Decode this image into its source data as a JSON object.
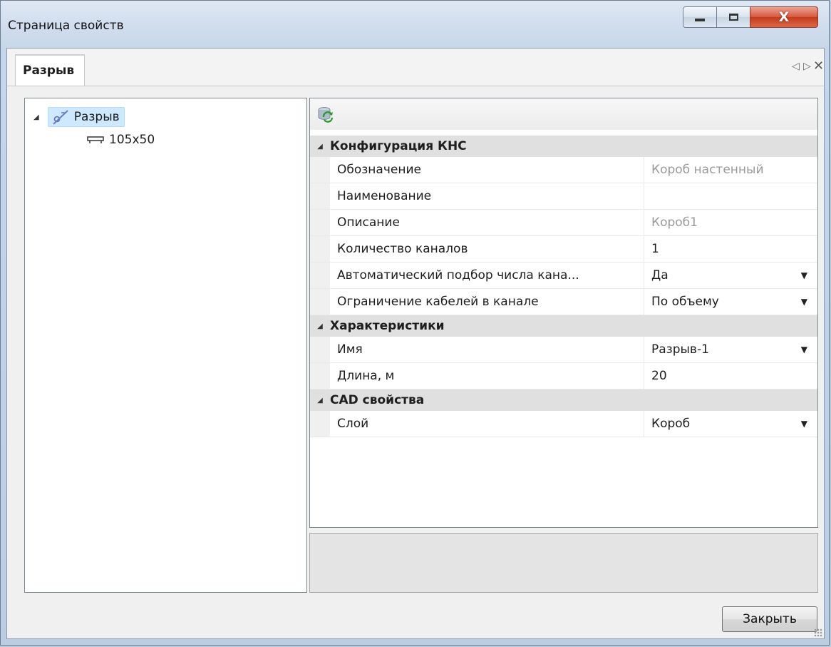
{
  "window": {
    "title": "Страница свойств",
    "close_glyph": "X"
  },
  "tab": {
    "label": "Разрыв",
    "prev_glyph": "◁",
    "next_glyph": "▷",
    "close_glyph": "✕"
  },
  "tree": {
    "root": {
      "label": "Разрыв",
      "icon": "break-line-icon",
      "selected": true,
      "expanded": true
    },
    "child": {
      "label": "105x50",
      "icon": "cable-tray-icon"
    }
  },
  "toolbar": {
    "refresh_icon": "refresh-db-icon"
  },
  "categories": [
    {
      "label": "Конфигурация КНС",
      "rows": [
        {
          "name": "Обозначение",
          "value": "Короб настенный",
          "readonly": true,
          "dropdown": false
        },
        {
          "name": "Наименование",
          "value": "",
          "readonly": false,
          "dropdown": false
        },
        {
          "name": "Описание",
          "value": "Короб1",
          "readonly": true,
          "dropdown": false
        },
        {
          "name": "Количество каналов",
          "value": "1",
          "readonly": false,
          "dropdown": false
        },
        {
          "name": "Автоматический подбор числа кана...",
          "value": "Да",
          "readonly": false,
          "dropdown": true
        },
        {
          "name": "Ограничение кабелей в канале",
          "value": "По объему",
          "readonly": false,
          "dropdown": true
        }
      ]
    },
    {
      "label": "Характеристики",
      "rows": [
        {
          "name": "Имя",
          "value": "Разрыв-1",
          "readonly": false,
          "dropdown": true
        },
        {
          "name": "Длина, м",
          "value": "20",
          "readonly": false,
          "dropdown": false
        }
      ]
    },
    {
      "label": "CAD свойства",
      "rows": [
        {
          "name": "Слой",
          "value": "Короб",
          "readonly": false,
          "dropdown": true
        }
      ]
    }
  ],
  "buttons": {
    "close_label": "Закрыть"
  },
  "colors": {
    "selection": "#cde8ff",
    "category_bg": "#e0e0e0",
    "readonly_text": "#9a9a9a"
  }
}
